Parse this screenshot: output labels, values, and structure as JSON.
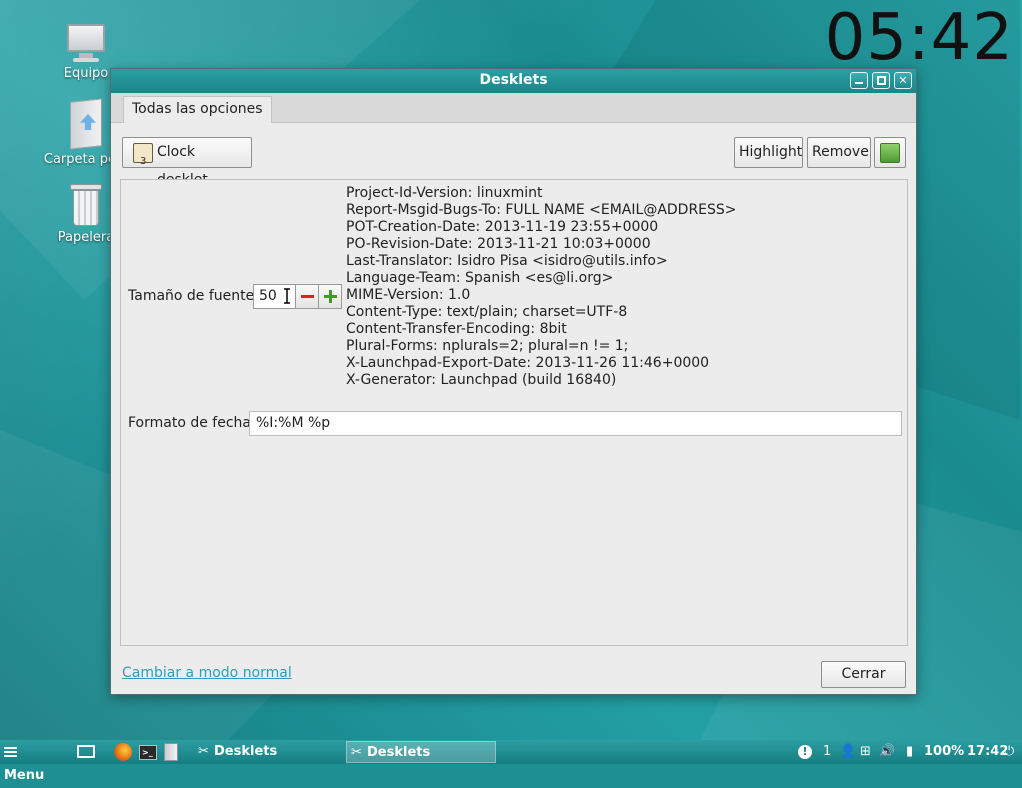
{
  "desktop": {
    "clock": "05:42",
    "icons": [
      {
        "label": "Equipo",
        "icon": "computer-icon"
      },
      {
        "label": "Carpeta pers",
        "icon": "home-folder-icon"
      },
      {
        "label": "Papelera",
        "icon": "trash-icon"
      }
    ]
  },
  "window": {
    "title": "Desklets",
    "tab": "Todas las opciones",
    "desklet_button": "Clock desklet",
    "highlight_button": "Highlight",
    "remove_button": "Remove",
    "font_size_label": "Tamaño de fuente:",
    "font_size_value": "50",
    "metadata": [
      "Project-Id-Version: linuxmint",
      "Report-Msgid-Bugs-To: FULL NAME <EMAIL@ADDRESS>",
      "POT-Creation-Date: 2013-11-19 23:55+0000",
      "PO-Revision-Date: 2013-11-21 10:03+0000",
      "Last-Translator: Isidro Pisa <isidro@utils.info>",
      "Language-Team: Spanish <es@li.org>",
      "MIME-Version: 1.0",
      "Content-Type: text/plain; charset=UTF-8",
      "Content-Transfer-Encoding: 8bit",
      "Plural-Forms: nplurals=2; plural=n != 1;",
      "X-Launchpad-Export-Date: 2013-11-26 11:46+0000",
      "X-Generator: Launchpad (build 16840)"
    ],
    "date_format_label": "Formato de fecha:",
    "date_format_value": "%I:%M %p",
    "switch_link": "Cambiar a modo normal",
    "close_button": "Cerrar"
  },
  "taskbar": {
    "menu_label": "Menu",
    "tasks": [
      {
        "label": "Desklets",
        "active": false
      },
      {
        "label": "Desklets",
        "active": true
      }
    ],
    "notification_count": "1",
    "battery": "100%",
    "time": "17:42"
  },
  "colors": {
    "accent": "#1e8f93",
    "link": "#2d9fb5"
  }
}
